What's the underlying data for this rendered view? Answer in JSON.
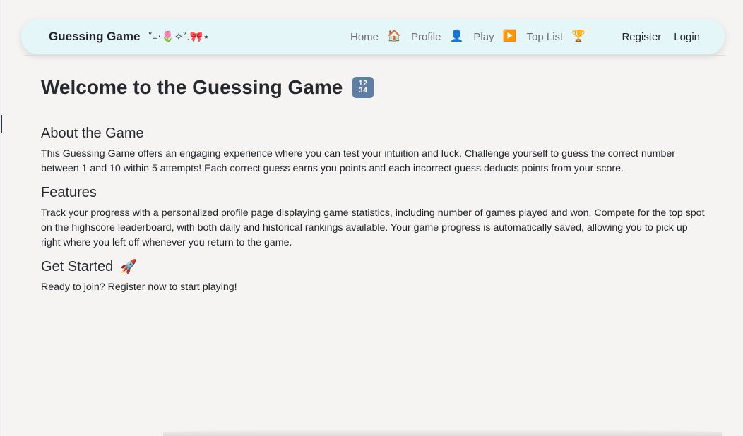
{
  "nav": {
    "brand": "Guessing Game",
    "brand_deco": "˚₊‧🌷✧˚.🎀⋆",
    "links": [
      {
        "label": "Home",
        "icon": "🏠",
        "icon_name": "house-icon"
      },
      {
        "label": "Profile",
        "icon": "👤",
        "icon_name": "user-icon"
      },
      {
        "label": "Play",
        "icon": "▶️",
        "icon_name": "play-icon"
      },
      {
        "label": "Top List",
        "icon": "🏆",
        "icon_name": "trophy-icon"
      }
    ],
    "register": "Register",
    "login": "Login"
  },
  "main": {
    "title": "Welcome to the Guessing Game",
    "title_icon": "numbers-icon",
    "title_icon_text": "12 34",
    "sections": [
      {
        "heading": "About the Game",
        "text": "This Guessing Game offers an engaging experience where you can test your intuition and luck. Challenge yourself to guess the correct number between 1 and 10 within 5 attempts! Each correct guess earns you points and each incorrect guess deducts points from your score."
      },
      {
        "heading": "Features",
        "text": "Track your progress with a personalized profile page displaying game statistics, including number of games played and won. Compete for the top spot on the highscore leaderboard, with both daily and historical rankings available. Your game progress is automatically saved, allowing you to pick up right where you left off whenever you return to the game."
      },
      {
        "heading": "Get Started",
        "heading_icon": "🚀",
        "heading_icon_name": "rocket-icon",
        "text": "Ready to join? Register now to start playing!"
      }
    ]
  },
  "colors": {
    "navbar_bg": "#e4f6f8",
    "page_bg": "#f5f4f3",
    "title_icon_bg": "#5d7fa6"
  }
}
